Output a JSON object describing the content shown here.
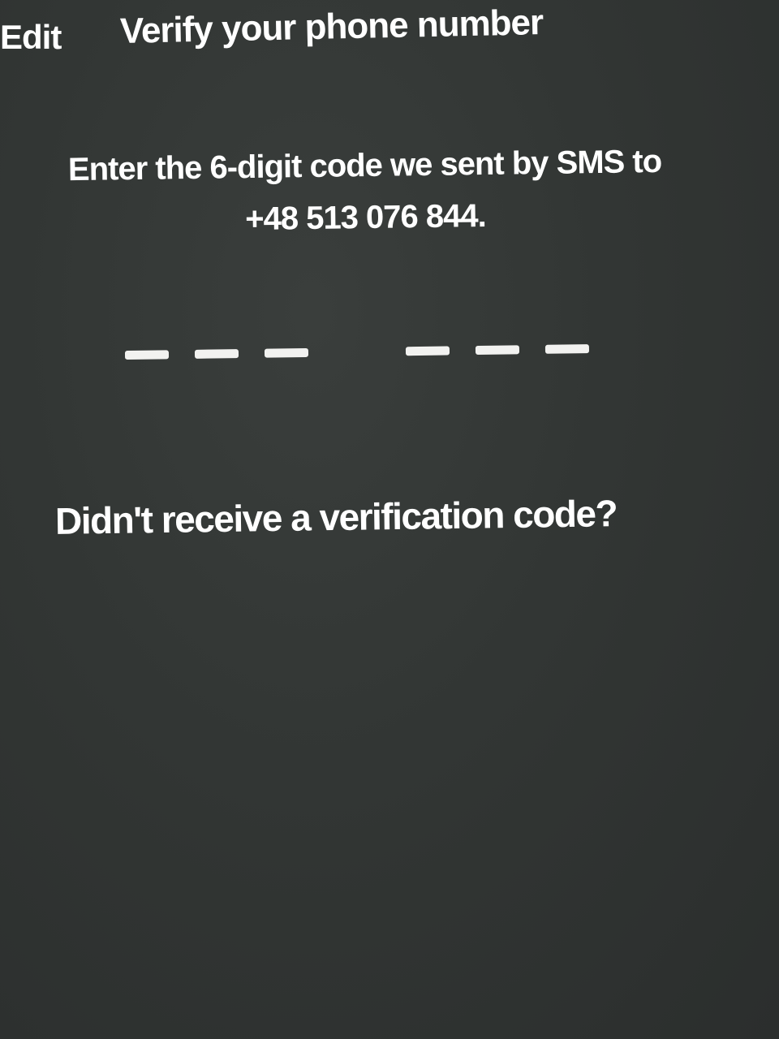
{
  "nav": {
    "back_label": "Edit",
    "title": "Verify your phone number"
  },
  "instructions": {
    "line1": "Enter the 6-digit code we sent by SMS to",
    "line2": "+48 513 076 844."
  },
  "code_input": {
    "digit_count": 6,
    "entered_digits": ""
  },
  "resend": {
    "label": "Didn't receive a verification code?"
  }
}
